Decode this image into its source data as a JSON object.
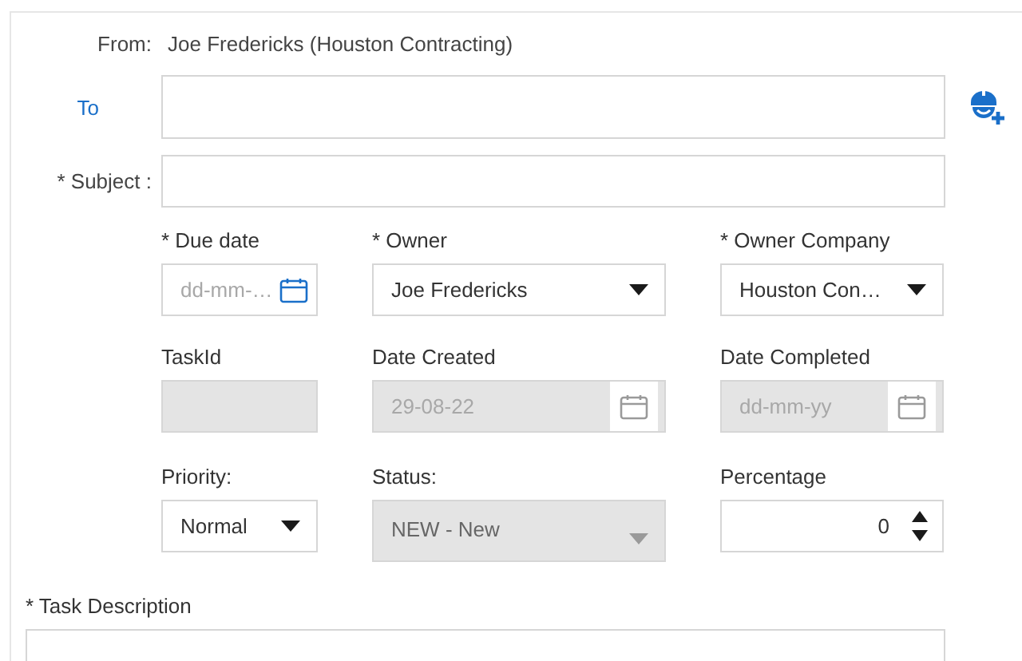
{
  "from": {
    "label": "From:",
    "value": "Joe Fredericks (Houston Contracting)"
  },
  "to": {
    "label": "To"
  },
  "subject": {
    "label": "* Subject :"
  },
  "fields": [
    {
      "kind": "date",
      "label": "* Due date",
      "placeholder": "dd-mm-…",
      "disabled": false
    },
    {
      "kind": "select",
      "label": "* Owner",
      "value": "Joe Fredericks",
      "disabled": false
    },
    {
      "kind": "select",
      "label": "* Owner Company",
      "value": "Houston Con…",
      "disabled": false
    },
    {
      "kind": "text",
      "label": "TaskId",
      "disabled": true
    },
    {
      "kind": "date",
      "label": "Date Created",
      "value": "29-08-22",
      "disabled": true
    },
    {
      "kind": "date",
      "label": "Date Completed",
      "placeholder": "dd-mm-yy",
      "disabled": true
    },
    {
      "kind": "select",
      "label": "Priority:",
      "value": "Normal",
      "disabled": false
    },
    {
      "kind": "select",
      "label": "Status:",
      "value": "NEW - New",
      "disabled": true
    },
    {
      "kind": "spinner",
      "label": "Percentage",
      "value": "0",
      "disabled": false
    }
  ],
  "description": {
    "label": "* Task Description"
  }
}
